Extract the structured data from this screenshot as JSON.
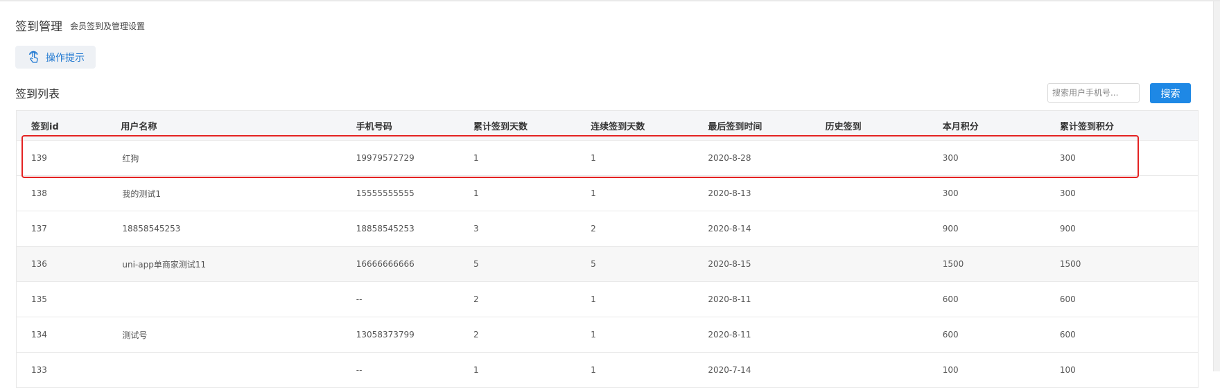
{
  "header": {
    "title": "签到管理",
    "subtitle": "会员签到及管理设置"
  },
  "tips": {
    "label": "操作提示",
    "icon": "hand-pointer-icon"
  },
  "list": {
    "title": "签到列表"
  },
  "search": {
    "placeholder": "搜索用户手机号...",
    "button_label": "搜索"
  },
  "colors": {
    "accent": "#1e88e5",
    "highlight": "#e42222"
  },
  "table": {
    "columns": [
      "签到id",
      "用户名称",
      "手机号码",
      "累计签到天数",
      "连续签到天数",
      "最后签到时间",
      "历史签到",
      "本月积分",
      "累计签到积分"
    ],
    "rows": [
      [
        "139",
        "红狗",
        "19979572729",
        "1",
        "1",
        "2020-8-28",
        "",
        "300",
        "300"
      ],
      [
        "138",
        "我的测试1",
        "15555555555",
        "1",
        "1",
        "2020-8-13",
        "",
        "300",
        "300"
      ],
      [
        "137",
        "18858545253",
        "18858545253",
        "3",
        "2",
        "2020-8-14",
        "",
        "900",
        "900"
      ],
      [
        "136",
        "uni-app单商家测试11",
        "16666666666",
        "5",
        "5",
        "2020-8-15",
        "",
        "1500",
        "1500"
      ],
      [
        "135",
        "",
        "--",
        "2",
        "1",
        "2020-8-11",
        "",
        "600",
        "600"
      ],
      [
        "134",
        "测试号",
        "13058373799",
        "2",
        "1",
        "2020-8-11",
        "",
        "600",
        "600"
      ],
      [
        "133",
        "",
        "--",
        "1",
        "1",
        "2020-7-14",
        "",
        "100",
        "100"
      ]
    ]
  }
}
